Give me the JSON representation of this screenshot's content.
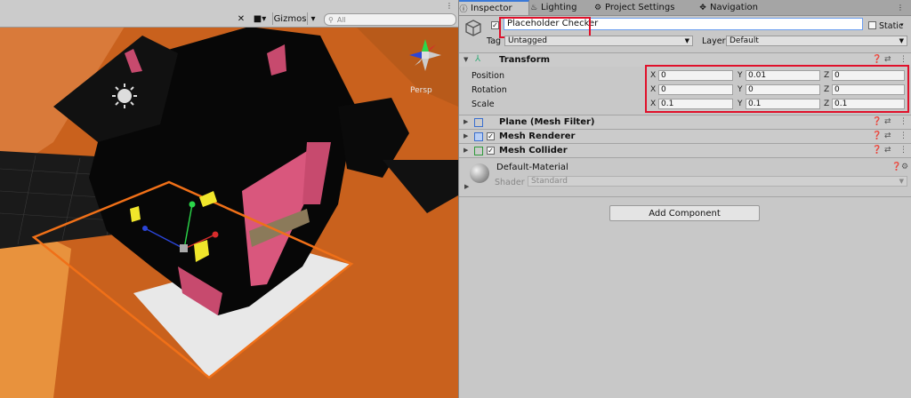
{
  "scene": {
    "gizmos_label": "Gizmos",
    "search_placeholder": "All",
    "persp_label": "Persp"
  },
  "tabs": [
    {
      "label": "Inspector",
      "icon": "info-icon"
    },
    {
      "label": "Lighting",
      "icon": "lightbulb-icon"
    },
    {
      "label": "Project Settings",
      "icon": "gear-icon"
    },
    {
      "label": "Navigation",
      "icon": "navigation-icon"
    }
  ],
  "object": {
    "name": "Placeholder Checker",
    "static_label": "Static",
    "tag_label": "Tag",
    "tag_value": "Untagged",
    "layer_label": "Layer",
    "layer_value": "Default"
  },
  "transform": {
    "title": "Transform",
    "rows": [
      {
        "label": "Position",
        "x": "0",
        "y": "0.01",
        "z": "0"
      },
      {
        "label": "Rotation",
        "x": "0",
        "y": "0",
        "z": "0"
      },
      {
        "label": "Scale",
        "x": "0.1",
        "y": "0.1",
        "z": "0.1"
      }
    ],
    "axis_x": "X",
    "axis_y": "Y",
    "axis_z": "Z"
  },
  "components": [
    {
      "title": "Plane (Mesh Filter)"
    },
    {
      "title": "Mesh Renderer"
    },
    {
      "title": "Mesh Collider"
    }
  ],
  "material": {
    "name": "Default-Material",
    "shader_label": "Shader",
    "shader_value": "Standard"
  },
  "add_component_label": "Add Component",
  "colors": {
    "highlight": "#e0102a",
    "accent": "#3a79d8",
    "floor": "#c9611d"
  }
}
